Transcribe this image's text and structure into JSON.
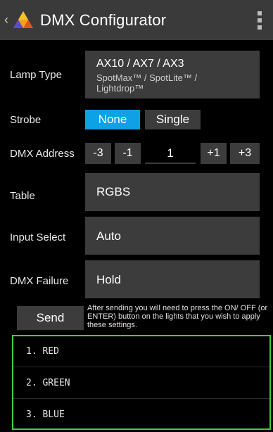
{
  "appbar": {
    "title": "DMX Configurator",
    "back_icon": "chevron-left-icon",
    "logo_icon": "triangle-logo-icon",
    "menu_icon": "vertical-dots-menu-icon"
  },
  "form": {
    "lamp_type": {
      "label": "Lamp Type",
      "value_line1": "AX10 / AX7 / AX3",
      "value_line2": "SpotMax™ / SpotLite™ / Lightdrop™"
    },
    "strobe": {
      "label": "Strobe",
      "options": [
        "None",
        "Single"
      ],
      "selected": "None"
    },
    "dmx_address": {
      "label": "DMX Address",
      "minus3": "-3",
      "minus1": "-1",
      "value": "1",
      "plus1": "+1",
      "plus3": "+3"
    },
    "table": {
      "label": "Table",
      "value": "RGBS"
    },
    "input_select": {
      "label": "Input Select",
      "value": "Auto"
    },
    "dmx_failure": {
      "label": "DMX Failure",
      "value": "Hold"
    }
  },
  "send": {
    "label": "Send",
    "note": "After sending you will need to press the ON/ OFF (or ENTER) button on the lights that you wish to apply these settings."
  },
  "list": {
    "items": [
      "1. RED",
      "2. GREEN",
      "3. BLUE"
    ]
  },
  "colors": {
    "accent": "#0ea1e6",
    "highlight_border": "#3fcf3f",
    "panel": "#3c3c3c"
  }
}
